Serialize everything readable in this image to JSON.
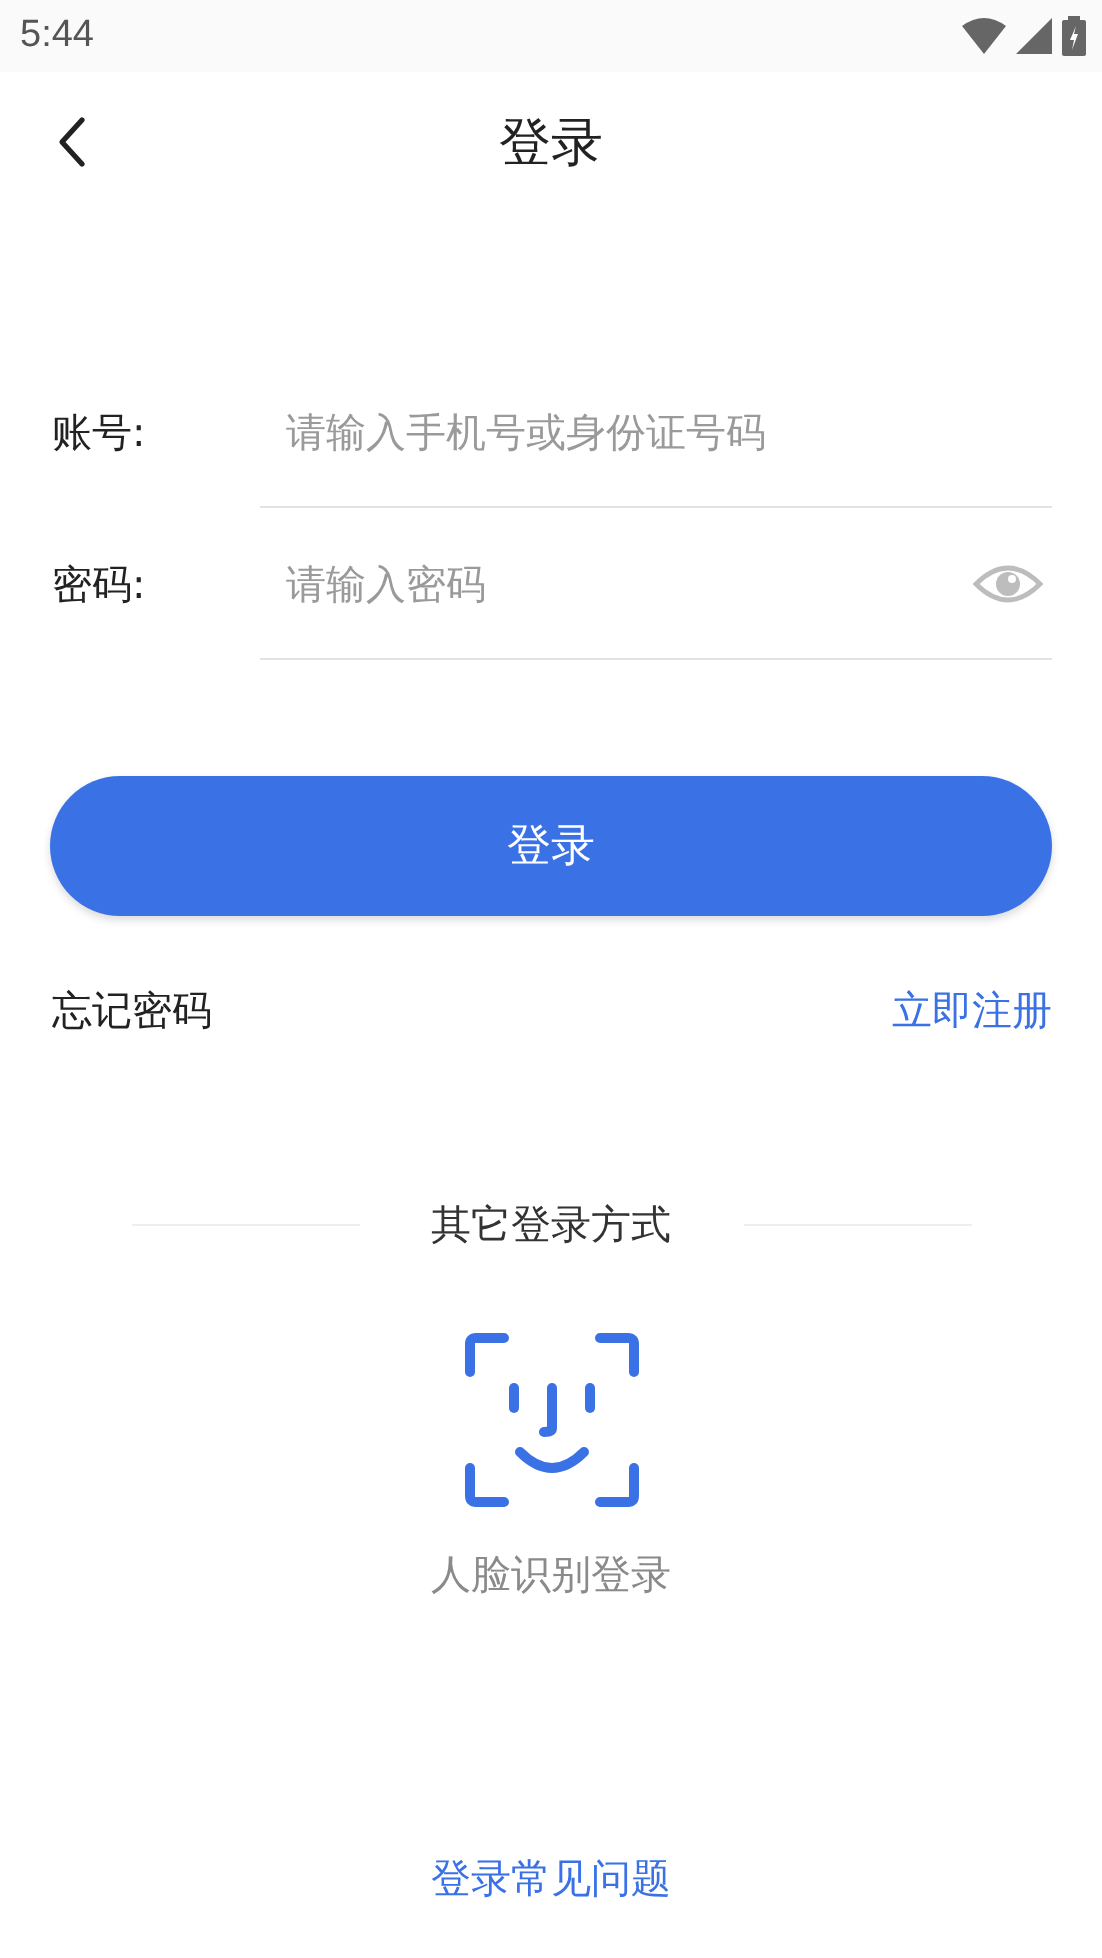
{
  "status_bar": {
    "time": "5:44"
  },
  "nav": {
    "title": "登录"
  },
  "fields": [
    {
      "label": "账号:",
      "placeholder": "请输入手机号或身份证号码",
      "kind": "text"
    },
    {
      "label": "密码:",
      "placeholder": "请输入密码",
      "kind": "password"
    }
  ],
  "login_button": "登录",
  "links": {
    "forgot": "忘记密码",
    "register": "立即注册"
  },
  "other_login": {
    "heading": "其它登录方式",
    "face_login": "人脸识别登录"
  },
  "help_link": "登录常见问题"
}
